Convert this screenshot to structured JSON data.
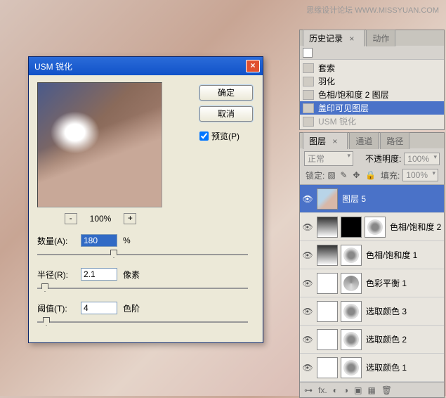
{
  "watermark": "思缘设计论坛  WWW.MISSYUAN.COM",
  "usm": {
    "title": "USM 锐化",
    "ok": "确定",
    "cancel": "取消",
    "preview_label": "预览(P)",
    "zoom": "100%",
    "amount_label": "数量(A):",
    "amount_value": "180",
    "amount_unit": "%",
    "radius_label": "半径(R):",
    "radius_value": "2.1",
    "radius_unit": "像素",
    "thresh_label": "阈值(T):",
    "thresh_value": "4",
    "thresh_unit": "色阶"
  },
  "history": {
    "tab1": "历史记录",
    "tab2": "动作",
    "items": [
      {
        "label": "套索"
      },
      {
        "label": "羽化"
      },
      {
        "label": "色相/饱和度 2 图层"
      },
      {
        "label": "盖印可见图层",
        "sel": true
      },
      {
        "label": "USM 锐化",
        "dim": true
      }
    ]
  },
  "layers": {
    "tab1": "图层",
    "tab2": "通道",
    "tab3": "路径",
    "blend": "正常",
    "opacity_label": "不透明度:",
    "opacity": "100%",
    "lock_label": "锁定:",
    "fill_label": "填充:",
    "fill": "100%",
    "items": [
      {
        "name": "图层 5",
        "type": "img",
        "sel": true
      },
      {
        "name": "色相/饱和度 2",
        "type": "adj",
        "mask": "grad_blk"
      },
      {
        "name": "色相/饱和度 1",
        "type": "adj",
        "mask": "grad"
      },
      {
        "name": "色彩平衡 1",
        "type": "bal",
        "mask": "white"
      },
      {
        "name": "选取颜色 3",
        "type": "adj",
        "mask": "white"
      },
      {
        "name": "选取颜色 2",
        "type": "adj",
        "mask": "white"
      },
      {
        "name": "选取颜色 1",
        "type": "adj",
        "mask": "white"
      }
    ]
  }
}
